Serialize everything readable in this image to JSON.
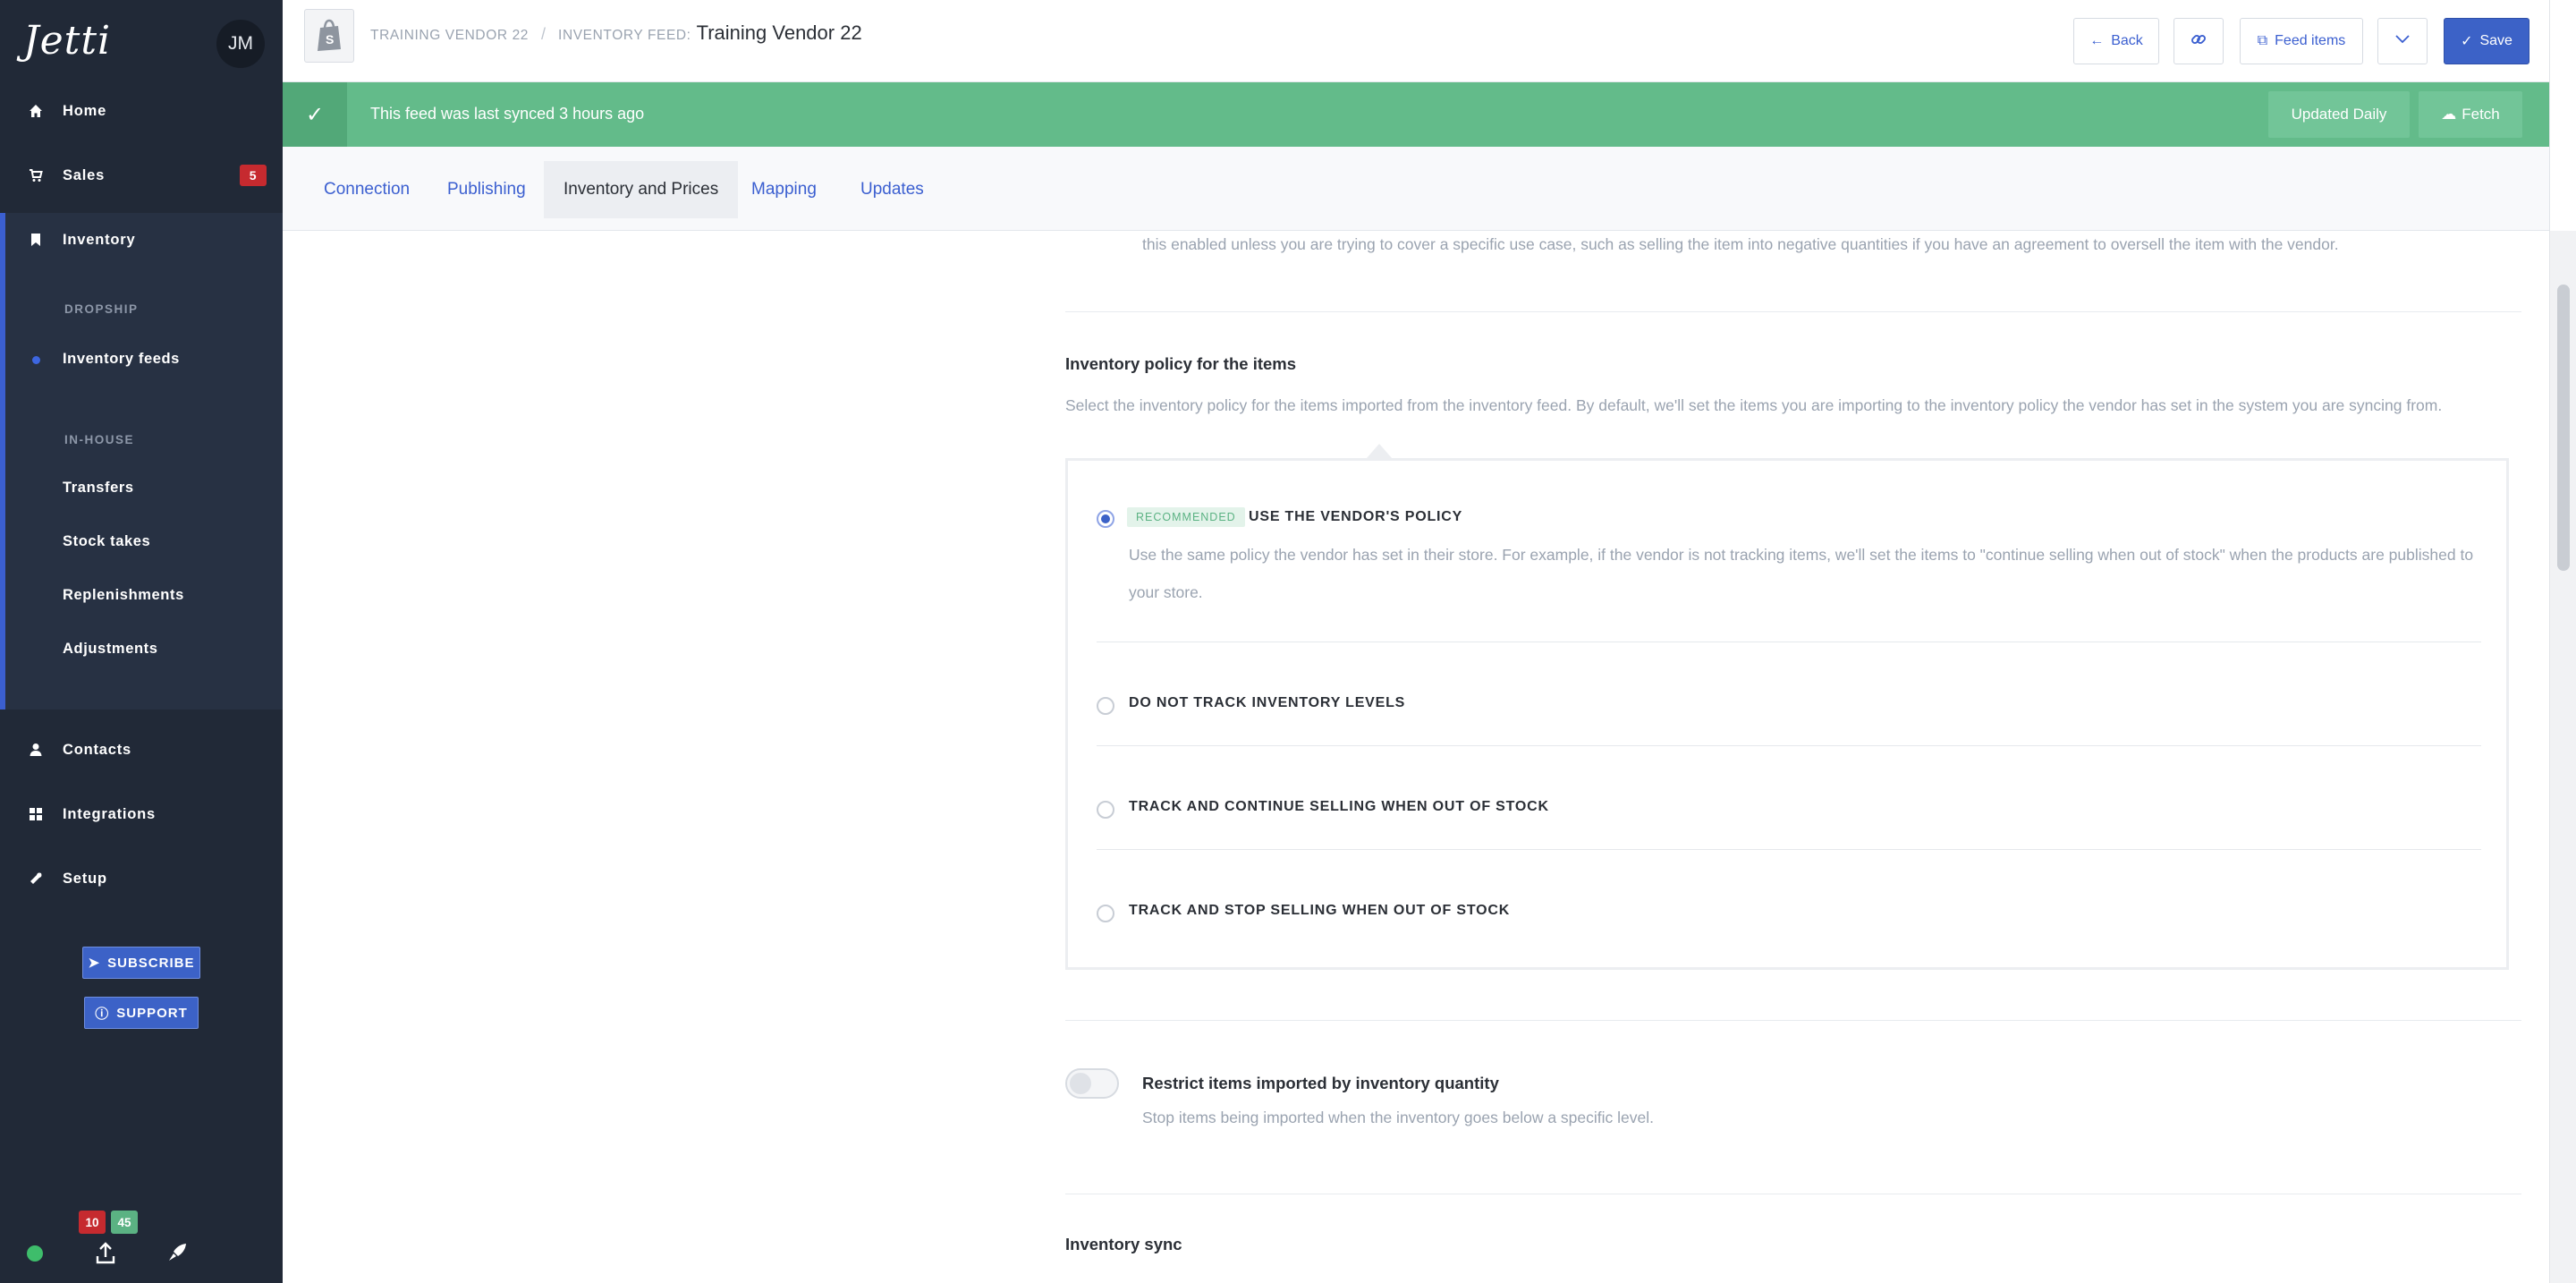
{
  "sidebar": {
    "logo": "Jetti",
    "avatar_initials": "JM",
    "nav": {
      "home": "Home",
      "sales": "Sales",
      "sales_badge": "5",
      "inventory": "Inventory",
      "contacts": "Contacts",
      "integrations": "Integrations",
      "setup": "Setup"
    },
    "dropship_label": "DROPSHIP",
    "inventory_feeds": "Inventory feeds",
    "inhouse_label": "IN-HOUSE",
    "inhouse_items": [
      "Transfers",
      "Stock takes",
      "Replenishments",
      "Adjustments"
    ],
    "subscribe_label": "SUBSCRIBE",
    "support_label": "SUPPORT",
    "footer_badges": {
      "red": "10",
      "green": "45"
    },
    "colors": {
      "bg": "#212937",
      "active_bar": "#3b5fd0",
      "badge_red": "#c62a2f",
      "badge_green": "#5bb283",
      "status_dot": "#3ebd6b"
    }
  },
  "header": {
    "breadcrumb_vendor": "TRAINING VENDOR 22",
    "breadcrumb_separator": "/",
    "breadcrumb_feed_label": "INVENTORY FEED:",
    "title": "Training Vendor 22",
    "back_label": "Back",
    "feed_items_label": "Feed items",
    "save_label": "Save"
  },
  "banner": {
    "message": "This feed was last synced 3 hours ago",
    "updated_label": "Updated Daily",
    "fetch_label": "Fetch",
    "color": "#63bb8a"
  },
  "tabs": [
    "Connection",
    "Publishing",
    "Inventory and Prices",
    "Mapping",
    "Updates"
  ],
  "active_tab": "Inventory and Prices",
  "content": {
    "intro_tail": "this enabled unless you are trying to cover a specific use case, such as selling the item into negative quantities if you have an agreement to oversell the item with the vendor.",
    "policy_heading": "Inventory policy for the items",
    "policy_desc": "Select the inventory policy for the items imported from the inventory feed. By default, we'll set the items you are importing to the inventory policy the vendor has set in the system you are syncing from.",
    "options": [
      {
        "label": "USE THE VENDOR'S POLICY",
        "badge": "RECOMMENDED",
        "selected": true,
        "desc": "Use the same policy the vendor has set in their store. For example, if the vendor is not tracking items, we'll set the items to \"continue selling when out of stock\" when the products are published to your store."
      },
      {
        "label": "DO NOT TRACK INVENTORY LEVELS",
        "selected": false
      },
      {
        "label": "TRACK AND CONTINUE SELLING WHEN OUT OF STOCK",
        "selected": false
      },
      {
        "label": "TRACK AND STOP SELLING WHEN OUT OF STOCK",
        "selected": false
      }
    ],
    "restrict_heading": "Restrict items imported by inventory quantity",
    "restrict_desc": "Stop items being imported when the inventory goes below a specific level.",
    "restrict_enabled": false,
    "sync_heading": "Inventory sync"
  },
  "icons": {
    "home": "home-icon",
    "sales": "cart-icon",
    "inventory": "bookmark-icon",
    "contacts": "person-icon",
    "integrations": "grid-icon",
    "setup": "wrench-icon"
  }
}
